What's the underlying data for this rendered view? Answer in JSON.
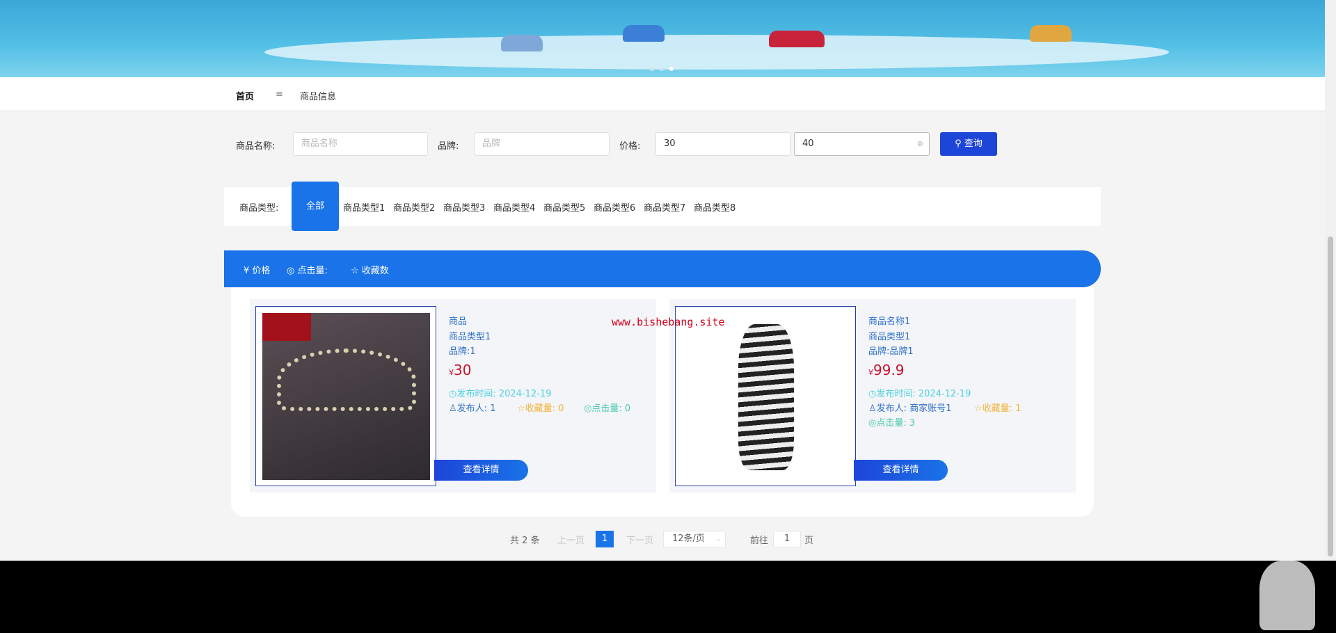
{
  "nav": {
    "home": "首页",
    "separator": "≡",
    "current": "商品信息"
  },
  "search": {
    "name_label": "商品名称:",
    "name_placeholder": "商品名称",
    "brand_label": "品牌:",
    "brand_placeholder": "品牌",
    "price_label": "价格:",
    "price_min": "30",
    "price_max": "40",
    "button": "查询"
  },
  "types": {
    "label": "商品类型:",
    "all": "全部",
    "items": [
      "商品类型1",
      "商品类型2",
      "商品类型3",
      "商品类型4",
      "商品类型5",
      "商品类型6",
      "商品类型7",
      "商品类型8"
    ]
  },
  "sort": {
    "price": "¥ 价格",
    "clicks": "◎ 点击量:",
    "favorites": "☆ 收藏数"
  },
  "watermark": "www.bishebang.site",
  "products": [
    {
      "name": "商品",
      "type": "商品类型1",
      "brand": "品牌:1",
      "currency": "¥",
      "price": "30",
      "publish_label": "发布时间:",
      "publish_date": "2024-12-19",
      "publisher_label": "发布人:",
      "publisher": "1",
      "fav_label": "收藏量:",
      "fav": "0",
      "click_label": "点击量:",
      "clicks": "0",
      "button": "查看详情"
    },
    {
      "name": "商品名称1",
      "type": "商品类型1",
      "brand": "品牌:品牌1",
      "currency": "¥",
      "price": "99.9",
      "publish_label": "发布时间:",
      "publish_date": "2024-12-19",
      "publisher_label": "发布人:",
      "publisher": "商家账号1",
      "fav_label": "收藏量:",
      "fav": "1",
      "click_label": "点击量:",
      "clicks": "3",
      "button": "查看详情"
    }
  ],
  "pagination": {
    "total": "共 2 条",
    "prev": "上一页",
    "current": "1",
    "next": "下一页",
    "page_size": "12条/页",
    "goto_label": "前往",
    "goto_value": "1",
    "page_suffix": "页"
  }
}
